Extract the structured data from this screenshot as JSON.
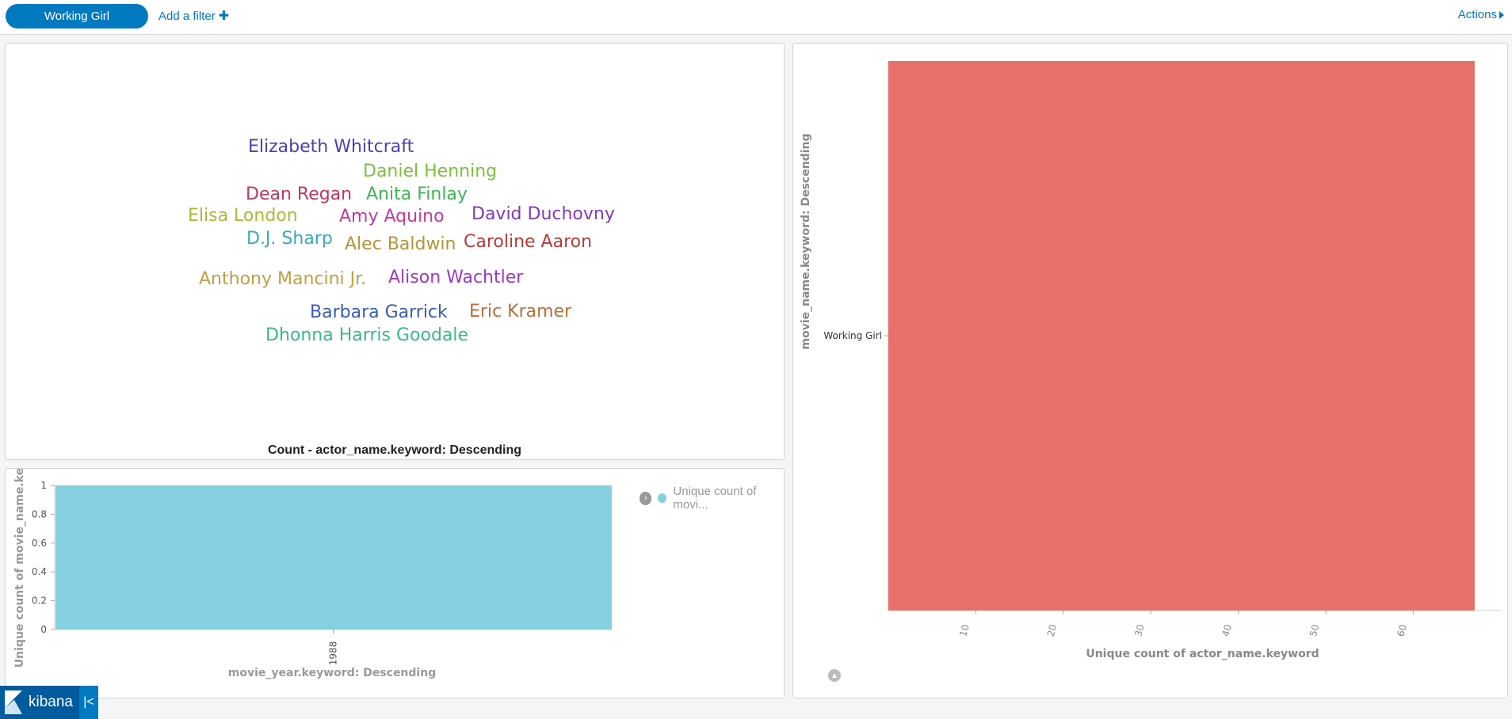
{
  "filter_bar": {
    "pill_label": "Working Girl",
    "add_filter_label": "Add a filter",
    "actions_label": "Actions"
  },
  "word_cloud": {
    "title": "Count - actor_name.keyword: Descending",
    "words": [
      {
        "text": "Elizabeth Whitcraft",
        "color": "#4e3fb3"
      },
      {
        "text": "Daniel Henning",
        "color": "#7dbf3e"
      },
      {
        "text": "Dean Regan",
        "color": "#b83a63"
      },
      {
        "text": "Anita Finlay",
        "color": "#3fb356"
      },
      {
        "text": "Elisa London",
        "color": "#a9b83a"
      },
      {
        "text": "Amy Aquino",
        "color": "#c23a9a"
      },
      {
        "text": "David Duchovny",
        "color": "#7f3ab8"
      },
      {
        "text": "D.J. Sharp",
        "color": "#3aa9b8"
      },
      {
        "text": "Alec Baldwin",
        "color": "#b8923a"
      },
      {
        "text": "Caroline Aaron",
        "color": "#b83a3a"
      },
      {
        "text": "Anthony Mancini Jr.",
        "color": "#c0a042"
      },
      {
        "text": "Alison Wachtler",
        "color": "#9a3ac2"
      },
      {
        "text": "Barbara Garrick",
        "color": "#3a5cb8"
      },
      {
        "text": "Eric Kramer",
        "color": "#b86f3a"
      },
      {
        "text": "Dhonna Harris Goodale",
        "color": "#3ab88a"
      }
    ]
  },
  "chart_data": [
    {
      "type": "bar",
      "orientation": "horizontal",
      "categories": [
        "Working Girl"
      ],
      "series": [
        {
          "name": "",
          "values": [
            67
          ],
          "color": "#e8706a"
        }
      ],
      "xlabel": "Unique count of actor_name.keyword",
      "ylabel": "movie_name.keyword: Descending",
      "xlim": [
        0,
        70
      ],
      "xticks": [
        10,
        20,
        30,
        40,
        50,
        60
      ]
    },
    {
      "type": "bar",
      "categories": [
        "1988"
      ],
      "series": [
        {
          "name": "Unique count of movi...",
          "values": [
            1
          ],
          "color": "#84d0e0"
        }
      ],
      "xlabel": "movie_year.keyword: Descending",
      "ylabel": "Unique count of movie_name.keyw",
      "ylim": [
        0,
        1
      ],
      "yticks": [
        "0",
        "0.2",
        "0.4",
        "0.6",
        "0.8",
        "1"
      ]
    }
  ],
  "branding": {
    "logo_text": "kibana",
    "collapse_glyph": "|<"
  }
}
